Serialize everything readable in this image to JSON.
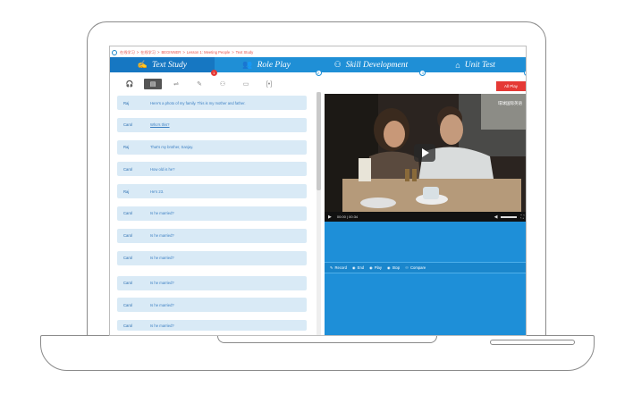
{
  "breadcrumb": [
    "在线学习",
    ">",
    "在线学习",
    ">",
    "BEGINNER",
    ">",
    "Lesson 1: Meeting People",
    ">",
    "Text Study"
  ],
  "tabs": [
    {
      "label": "Text Study",
      "num": "1",
      "icon": "study-icon"
    },
    {
      "label": "Role Play",
      "num": "2",
      "icon": "role-play-icon"
    },
    {
      "label": "Skill Development",
      "num": "3",
      "icon": "skill-icon"
    },
    {
      "label": "Unit Test",
      "num": "4",
      "icon": "unit-test-icon"
    }
  ],
  "toolbar_icons": [
    "headphones-icon",
    "document-icon",
    "dialog-icon",
    "edit-icon",
    "people-icon",
    "card-icon",
    "code-icon"
  ],
  "dialog": [
    {
      "speaker": "Raj",
      "text": "Here's a photo of my family. This is my mother and father."
    },
    {
      "speaker": "Carol",
      "text": "Who's this?"
    },
    {
      "speaker": "Raj",
      "text": "That's my brother, Sanjay."
    },
    {
      "speaker": "Carol",
      "text": "How old is he?"
    },
    {
      "speaker": "Raj",
      "text": "He's 23."
    },
    {
      "speaker": "Carol",
      "text": "Is he married?"
    },
    {
      "speaker": "Carol",
      "text": "Is he married?"
    },
    {
      "speaker": "Carol",
      "text": "Is he married?"
    },
    {
      "speaker": "Carol",
      "text": "Is he married?"
    },
    {
      "speaker": "Carol",
      "text": "Is he married?"
    },
    {
      "speaker": "Carol",
      "text": "Is he married?"
    }
  ],
  "all_play": "All Play",
  "video": {
    "watermark": "環球国际英语",
    "time": "00:00 | 00:34"
  },
  "record_bar": [
    {
      "icon": "mic-icon",
      "label": "Record"
    },
    {
      "icon": "end-icon",
      "label": "End"
    },
    {
      "icon": "play-icon",
      "label": "Play"
    },
    {
      "icon": "stop-icon",
      "label": "Stop"
    },
    {
      "icon": "compare-icon",
      "label": "Compare"
    }
  ],
  "colors": {
    "accent": "#1f8fd6",
    "active_tab": "#1677c2",
    "row_bg": "#d9eaf6",
    "all_play": "#e53935",
    "panel_blue": "#1e8fd8"
  }
}
